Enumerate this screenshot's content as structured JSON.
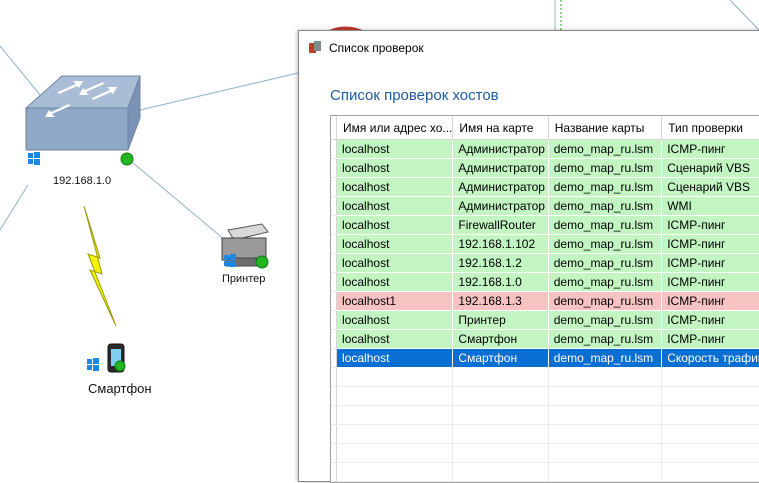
{
  "map": {
    "switch_label": "192.168.1.0",
    "printer_label": "Принтер",
    "smartphone_label": "Смартфон",
    "colors": {
      "link": "#8fb4c4",
      "status_ok": "#22b622",
      "lightning": "#f2f20a"
    }
  },
  "dialog": {
    "title": "Список проверок",
    "heading": "Список проверок хостов",
    "columns": [
      "Имя или адрес хо...",
      "Имя на карте",
      "Название карты",
      "Тип проверки"
    ],
    "rows": [
      {
        "state": "ok",
        "cells": [
          "localhost",
          "Администратор",
          "demo_map_ru.lsm",
          "ICMP-пинг"
        ]
      },
      {
        "state": "ok",
        "cells": [
          "localhost",
          "Администратор",
          "demo_map_ru.lsm",
          "Сценарий VBS"
        ]
      },
      {
        "state": "ok",
        "cells": [
          "localhost",
          "Администратор",
          "demo_map_ru.lsm",
          "Сценарий VBS"
        ]
      },
      {
        "state": "ok",
        "cells": [
          "localhost",
          "Администратор",
          "demo_map_ru.lsm",
          "WMI"
        ]
      },
      {
        "state": "ok",
        "cells": [
          "localhost",
          "FirewallRouter",
          "demo_map_ru.lsm",
          "ICMP-пинг"
        ]
      },
      {
        "state": "ok",
        "cells": [
          "localhost",
          "192.168.1.102",
          "demo_map_ru.lsm",
          "ICMP-пинг"
        ]
      },
      {
        "state": "ok",
        "cells": [
          "localhost",
          "192.168.1.2",
          "demo_map_ru.lsm",
          "ICMP-пинг"
        ]
      },
      {
        "state": "ok",
        "cells": [
          "localhost",
          "192.168.1.0",
          "demo_map_ru.lsm",
          "ICMP-пинг"
        ]
      },
      {
        "state": "fail",
        "cells": [
          "localhost1",
          "192.168.1.3",
          "demo_map_ru.lsm",
          "ICMP-пинг"
        ]
      },
      {
        "state": "ok",
        "cells": [
          "localhost",
          "Принтер",
          "demo_map_ru.lsm",
          "ICMP-пинг"
        ]
      },
      {
        "state": "ok",
        "cells": [
          "localhost",
          "Смартфон",
          "demo_map_ru.lsm",
          "ICMP-пинг"
        ]
      },
      {
        "state": "sel",
        "cells": [
          "localhost",
          "Смартфон",
          "demo_map_ru.lsm",
          "Скорость трафика"
        ]
      }
    ],
    "colors": {
      "ok_row": "#c2f5c2",
      "fail_row": "#f7c2c2",
      "selected_row": "#0a6fd2",
      "heading": "#1d5aa0"
    }
  }
}
